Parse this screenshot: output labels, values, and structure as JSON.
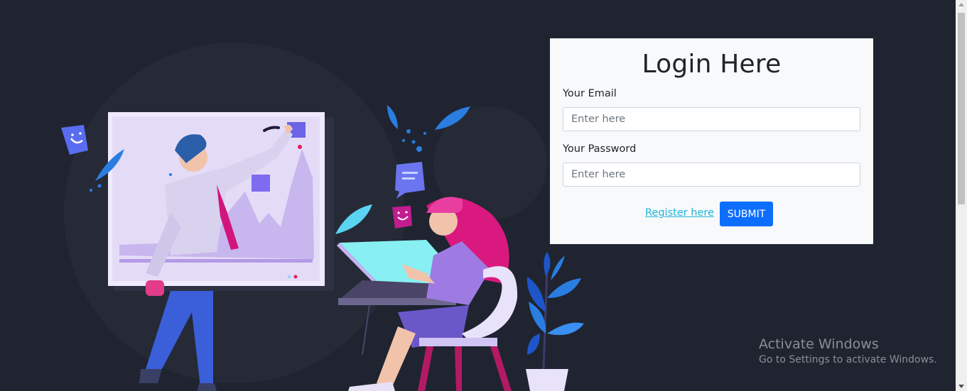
{
  "login": {
    "title": "Login Here",
    "email_label": "Your Email",
    "email_placeholder": "Enter here",
    "password_label": "Your Password",
    "password_placeholder": "Enter here",
    "register_link": "Register here",
    "submit_label": "SUBMIT"
  },
  "watermark": {
    "title": "Activate Windows",
    "subtitle": "Go to Settings to activate Windows."
  },
  "colors": {
    "background": "#1f2430",
    "card": "#f8f9fa",
    "primary": "#0d6efd",
    "link": "#1fb4d9"
  },
  "icons": [
    "smiley-sticky-note-icon",
    "leaf-icon",
    "plant-icon"
  ]
}
